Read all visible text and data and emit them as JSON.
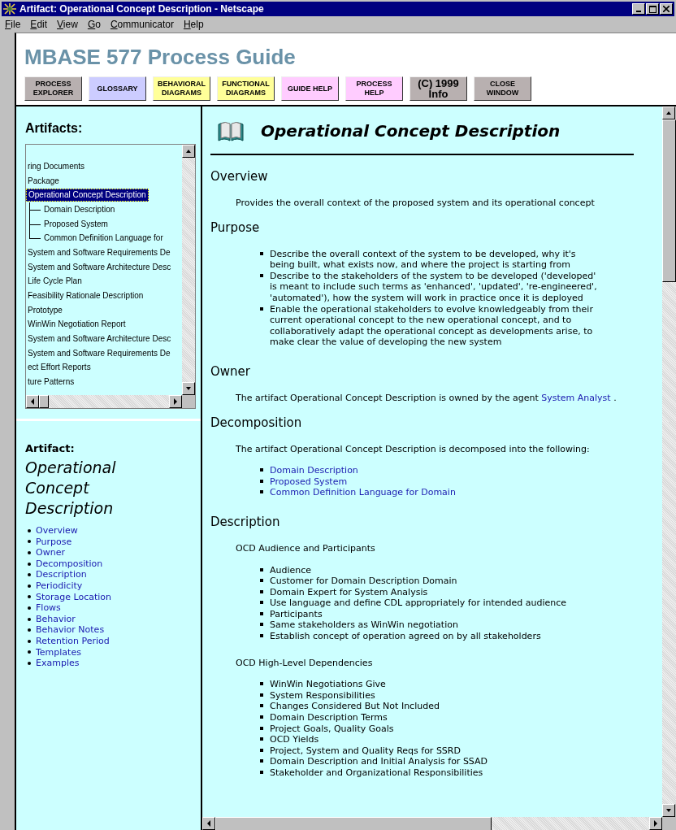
{
  "window": {
    "title": "Artifact: Operational Concept Description - Netscape"
  },
  "menu": [
    "File",
    "Edit",
    "View",
    "Go",
    "Communicator",
    "Help"
  ],
  "header": {
    "logo": "MBASE 577 Process Guide",
    "buttons": [
      {
        "label": "PROCESS EXPLORER",
        "kind": "gray"
      },
      {
        "label": "GLOSSARY",
        "kind": "lavender"
      },
      {
        "label": "BEHAVIORAL DIAGRAMS",
        "kind": "yellow"
      },
      {
        "label": "FUNCTIONAL DIAGRAMS",
        "kind": "yellow"
      },
      {
        "label": "GUIDE HELP",
        "kind": "pink"
      },
      {
        "label": "PROCESS HELP",
        "kind": "pink"
      },
      {
        "label": "(C) 1999 Info",
        "kind": "info"
      },
      {
        "label": "CLOSE WINDOW",
        "kind": "gray"
      }
    ]
  },
  "sidebar": {
    "title": "Artifacts:",
    "tree": [
      {
        "label": "ring Documents",
        "selected": false
      },
      {
        "label": "Package",
        "selected": false
      },
      {
        "label": "Operational Concept Description",
        "selected": true,
        "children": [
          {
            "label": "Domain Description",
            "selected": false
          },
          {
            "label": "Proposed System",
            "selected": false
          },
          {
            "label": "Common Definition Language for",
            "selected": false
          }
        ]
      },
      {
        "label": "System and Software Requirements De",
        "selected": false
      },
      {
        "label": "System and Software Architecture Desc",
        "selected": false
      },
      {
        "label": "Life Cycle Plan",
        "selected": false
      },
      {
        "label": "Feasibility Rationale Description",
        "selected": false
      },
      {
        "label": "Prototype",
        "selected": false
      },
      {
        "label": "WinWin Negotiation Report",
        "selected": false
      },
      {
        "label": "System and Software Architecture Desc",
        "selected": false
      },
      {
        "label": "System and Software Requirements De",
        "selected": false
      },
      {
        "label": "ect Effort Reports",
        "selected": false
      },
      {
        "label": "ture Patterns",
        "selected": false
      }
    ],
    "artifact_label": "Artifact:",
    "artifact_name": "Operational Concept Description",
    "links": [
      "Overview",
      "Purpose",
      "Owner",
      "Decomposition",
      "Description",
      "Periodicity",
      "Storage Location",
      "Flows",
      "Behavior",
      "Behavior Notes",
      "Retention Period",
      "Templates",
      "Examples"
    ]
  },
  "main": {
    "title": "Operational Concept Description",
    "sections": [
      {
        "heading": "Overview",
        "blocks": [
          {
            "kind": "para",
            "text": "Provides the overall context of the proposed system and its operational concept"
          }
        ]
      },
      {
        "heading": "Purpose",
        "blocks": [
          {
            "kind": "list",
            "items": [
              "Describe the overall context of the system to be developed, why it's being built, what exists now, and where the project is starting from",
              "Describe to the stakeholders of the system to be developed ('developed' is meant to include such terms as 'enhanced', 'updated', 're-engineered', 'automated'), how the system will work in practice once it is deployed",
              "Enable the operational stakeholders to evolve knowledgeably from their current operational concept to the new operational concept, and to collaboratively adapt the operational concept as developments arise, to make clear the value of developing the new system"
            ]
          }
        ]
      },
      {
        "heading": "Owner",
        "blocks": [
          {
            "kind": "para_link",
            "text": "The artifact Operational Concept Description is owned by the agent",
            "link": "System Analyst",
            "after": "."
          }
        ]
      },
      {
        "heading": "Decomposition",
        "blocks": [
          {
            "kind": "para",
            "text": "The artifact Operational Concept Description is decomposed into the following:"
          },
          {
            "kind": "links",
            "items": [
              "Domain Description",
              "Proposed System",
              "Common Definition Language for Domain"
            ]
          }
        ]
      },
      {
        "heading": "Description",
        "blocks": [
          {
            "kind": "para",
            "text": "OCD Audience and Participants"
          },
          {
            "kind": "list",
            "items": [
              "Audience",
              "Customer for Domain Description Domain",
              "Domain Expert for System Analysis",
              "Use language and define CDL appropriately for intended audience",
              "Participants",
              "Same stakeholders as WinWin negotiation",
              "Establish concept of operation agreed on by all stakeholders"
            ]
          },
          {
            "kind": "para",
            "text": "OCD High-Level Dependencies"
          },
          {
            "kind": "list",
            "items": [
              "WinWin Negotiations Give",
              "System Responsibilities",
              "Changes Considered But Not Included",
              "Domain Description Terms",
              "Project Goals, Quality Goals",
              "OCD Yields",
              "Project, System and Quality Reqs for SSRD",
              "Domain Description and Initial Analysis for SSAD",
              "Stakeholder and Organizational Responsibilities"
            ]
          }
        ]
      }
    ]
  }
}
